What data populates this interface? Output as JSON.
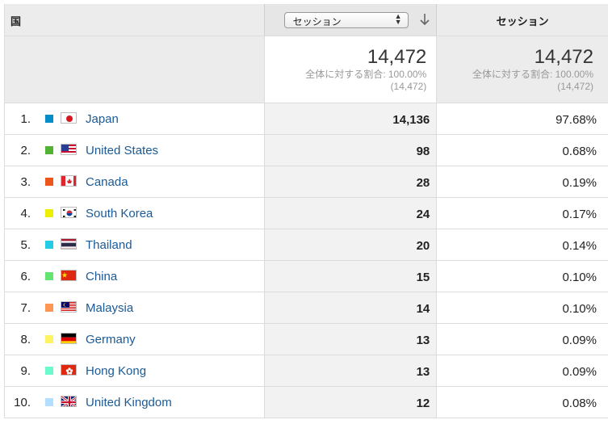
{
  "header": {
    "dimension_label": "国",
    "metric_select_value": "セッション",
    "metric_column_label": "セッション"
  },
  "totals": {
    "sessions_value": "14,472",
    "sessions_pct_line": "全体に対する割合: 100.00%",
    "sessions_total_line": "(14,472)",
    "share_value": "14,472",
    "share_pct_line": "全体に対する割合: 100.00%",
    "share_total_line": "(14,472)"
  },
  "rows": [
    {
      "rank": "1.",
      "country": "Japan",
      "sessions": "14,136",
      "share": "97.68%",
      "color": "#058dc7",
      "flag": "japan-flag-icon"
    },
    {
      "rank": "2.",
      "country": "United States",
      "sessions": "98",
      "share": "0.68%",
      "color": "#50b432",
      "flag": "united-states-flag-icon"
    },
    {
      "rank": "3.",
      "country": "Canada",
      "sessions": "28",
      "share": "0.19%",
      "color": "#ed561b",
      "flag": "canada-flag-icon"
    },
    {
      "rank": "4.",
      "country": "South Korea",
      "sessions": "24",
      "share": "0.17%",
      "color": "#edef00",
      "flag": "south-korea-flag-icon"
    },
    {
      "rank": "5.",
      "country": "Thailand",
      "sessions": "20",
      "share": "0.14%",
      "color": "#24cbe5",
      "flag": "thailand-flag-icon"
    },
    {
      "rank": "6.",
      "country": "China",
      "sessions": "15",
      "share": "0.10%",
      "color": "#64e572",
      "flag": "china-flag-icon"
    },
    {
      "rank": "7.",
      "country": "Malaysia",
      "sessions": "14",
      "share": "0.10%",
      "color": "#ff9655",
      "flag": "malaysia-flag-icon"
    },
    {
      "rank": "8.",
      "country": "Germany",
      "sessions": "13",
      "share": "0.09%",
      "color": "#fff263",
      "flag": "germany-flag-icon"
    },
    {
      "rank": "9.",
      "country": "Hong Kong",
      "sessions": "13",
      "share": "0.09%",
      "color": "#6aface",
      "flag": "hong-kong-flag-icon"
    },
    {
      "rank": "10.",
      "country": "United Kingdom",
      "sessions": "12",
      "share": "0.08%",
      "color": "#b2deff",
      "flag": "united-kingdom-flag-icon"
    }
  ]
}
